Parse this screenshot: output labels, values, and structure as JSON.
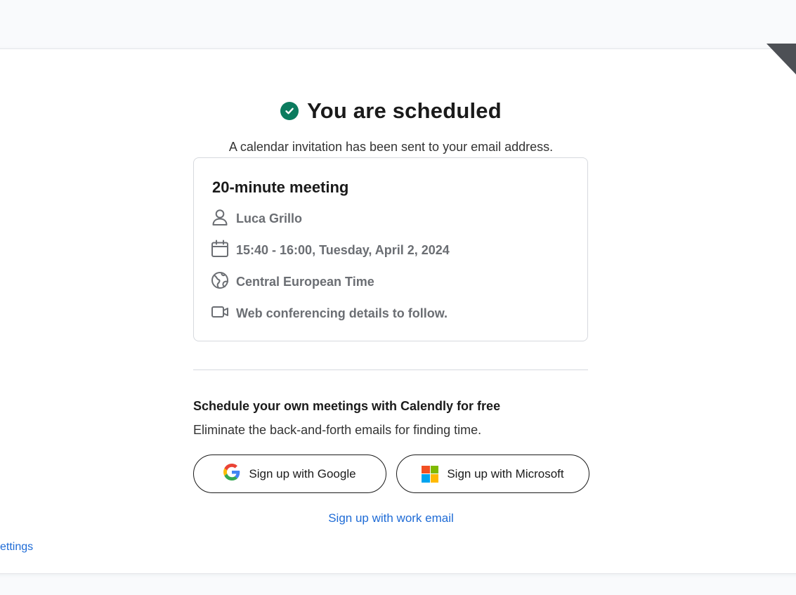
{
  "header": {
    "title": "You are scheduled",
    "subtitle": "A calendar invitation has been sent to your email address."
  },
  "event": {
    "title": "20-minute meeting",
    "host": "Luca Grillo",
    "datetime": "15:40 - 16:00, Tuesday, April 2, 2024",
    "timezone": "Central European Time",
    "conferencing": "Web conferencing details to follow."
  },
  "promo": {
    "title": "Schedule your own meetings with Calendly for free",
    "subtitle": "Eliminate the back-and-forth emails for finding time.",
    "google_label": "Sign up with Google",
    "microsoft_label": "Sign up with Microsoft",
    "work_email_label": "Sign up with work email"
  },
  "footer": {
    "settings_label": "ettings"
  },
  "colors": {
    "success": "#0b7b5e",
    "link": "#1e6bd6",
    "muted_text": "#6b6e73"
  }
}
